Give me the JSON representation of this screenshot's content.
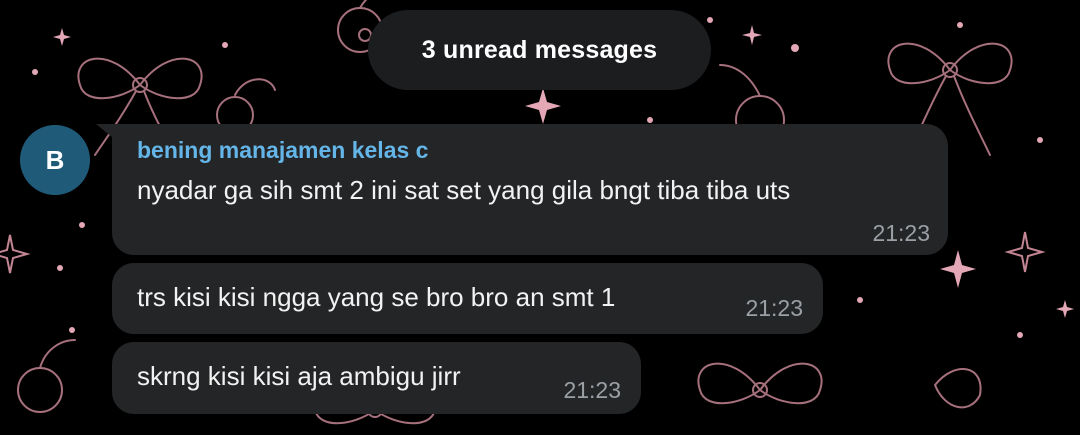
{
  "banner": {
    "unread_text": "3 unread messages"
  },
  "sender": {
    "avatar_letter": "B",
    "name": "bening manajamen kelas c",
    "name_color": "#64b5e8",
    "avatar_color": "#1f5a78"
  },
  "messages": [
    {
      "text": "nyadar ga sih smt 2 ini sat set yang gila bngt tiba tiba uts",
      "time": "21:23"
    },
    {
      "text": "trs kisi kisi ngga yang se bro bro an smt 1",
      "time": "21:23"
    },
    {
      "text": "skrng kisi kisi aja ambigu jirr",
      "time": "21:23"
    }
  ],
  "colors": {
    "background": "#000000",
    "bubble": "#232527",
    "wallpaper_line": "#e8a8b8"
  },
  "wallpaper_icons": [
    "bow-icon",
    "cherry-icon",
    "sparkle-icon",
    "dot-icon"
  ]
}
